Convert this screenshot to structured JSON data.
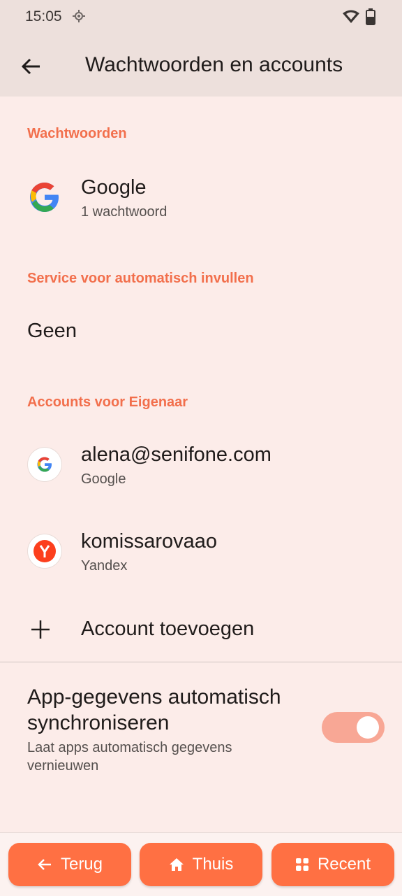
{
  "status": {
    "time": "15:05"
  },
  "appbar": {
    "title": "Wachtwoorden en accounts"
  },
  "passwords": {
    "header": "Wachtwoorden",
    "item": {
      "title": "Google",
      "subtitle": "1 wachtwoord",
      "icon": "google-logo-icon"
    }
  },
  "autofill": {
    "header": "Service voor automatisch invullen",
    "value": "Geen"
  },
  "accounts": {
    "header": "Accounts voor Eigenaar",
    "items": [
      {
        "title": "alena@senifone.com",
        "subtitle": "Google",
        "icon": "google-logo-icon"
      },
      {
        "title": "komissarovaao",
        "subtitle": "Yandex",
        "icon": "yandex-logo-icon"
      }
    ],
    "add_label": "Account toevoegen"
  },
  "sync": {
    "title": "App-gegevens automatisch synchroniseren",
    "subtitle": "Laat apps automatisch gegevens vernieuwen",
    "enabled": true
  },
  "navbar": {
    "back": "Terug",
    "home": "Thuis",
    "recent": "Recent"
  },
  "colors": {
    "accent": "#f26f4c",
    "nav_button": "#ff7043",
    "toggle_track": "#f8a795",
    "background": "#fcece9"
  }
}
